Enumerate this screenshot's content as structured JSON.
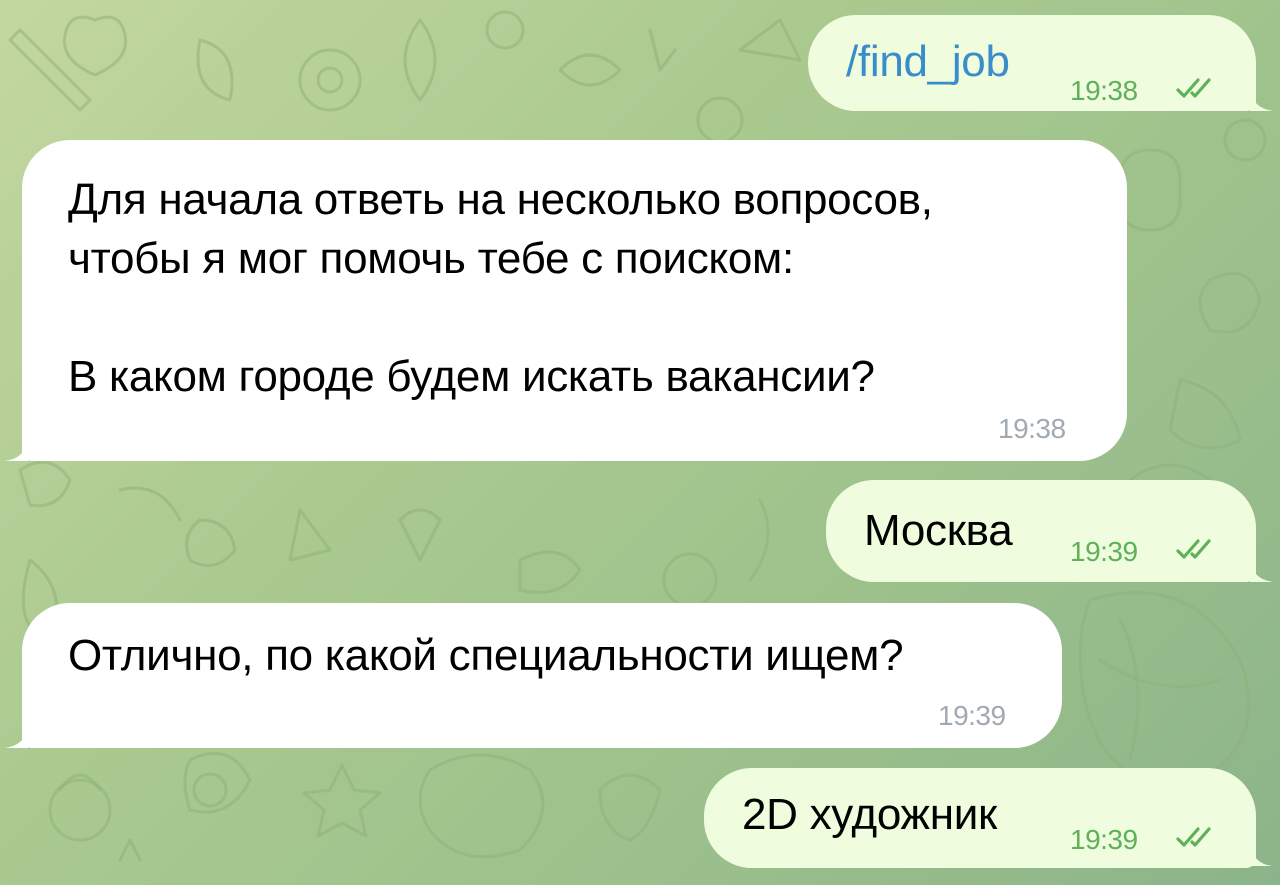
{
  "chat": {
    "messages": [
      {
        "direction": "outgoing",
        "text": "/find_job",
        "time": "19:38",
        "status": "read"
      },
      {
        "direction": "incoming",
        "text": "Для начала ответь на несколько вопросов,\nчтобы я мог помочь тебе с поиском:\n\nВ каком городе будем искать вакансии?",
        "time": "19:38"
      },
      {
        "direction": "outgoing",
        "text": "Москва",
        "time": "19:39",
        "status": "read"
      },
      {
        "direction": "incoming",
        "text": "Отлично, по какой специальности ищем?",
        "time": "19:39"
      },
      {
        "direction": "outgoing",
        "text": "2D художник",
        "time": "19:39",
        "status": "read"
      }
    ]
  },
  "icons": {
    "read_status": "double-check-icon",
    "wallpaper": "doodle-wallpaper"
  },
  "colors": {
    "outgoing_bubble": "#effdde",
    "incoming_bubble": "#ffffff",
    "check_time": "#5eb059",
    "incoming_time": "#a1aab3",
    "command_link": "#3a8cca",
    "wallpaper": "#a9c98f"
  }
}
